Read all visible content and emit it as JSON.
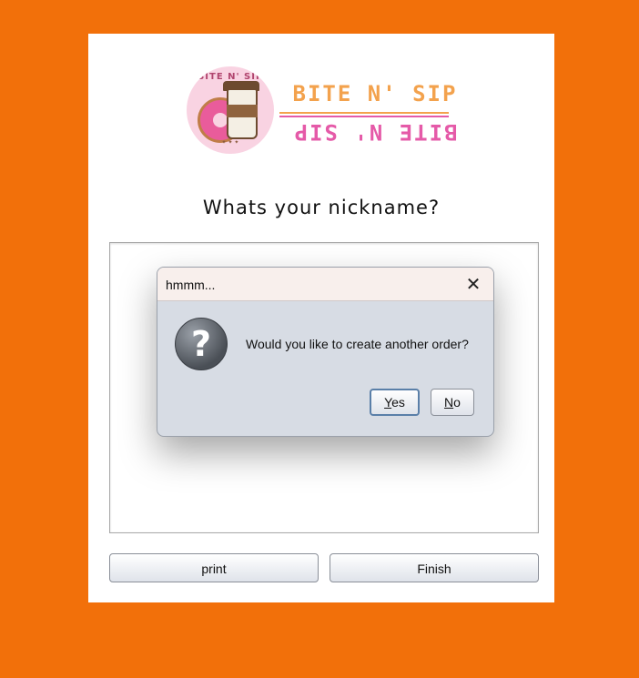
{
  "logo": {
    "badge_arc_text": "BITE N' SIP",
    "brand_text": "BITE N' SIP",
    "brand_mirrored_text": "BITE N' SIP",
    "badge_bottom_text": "✦ ✦ ✦"
  },
  "form": {
    "question": "Whats your nickname?",
    "nickname_value": "",
    "print_label": "print",
    "finish_label": "Finish"
  },
  "dialog": {
    "title": "hmmm...",
    "close_glyph": "✕",
    "icon": "question-icon",
    "message": "Would you like to create another order?",
    "yes_mnemonic": "Y",
    "yes_rest": "es",
    "no_mnemonic": "N",
    "no_rest": "o"
  },
  "colors": {
    "background": "#f2700a",
    "brand_orange": "#f3a24d",
    "brand_pink": "#e55aa8"
  }
}
